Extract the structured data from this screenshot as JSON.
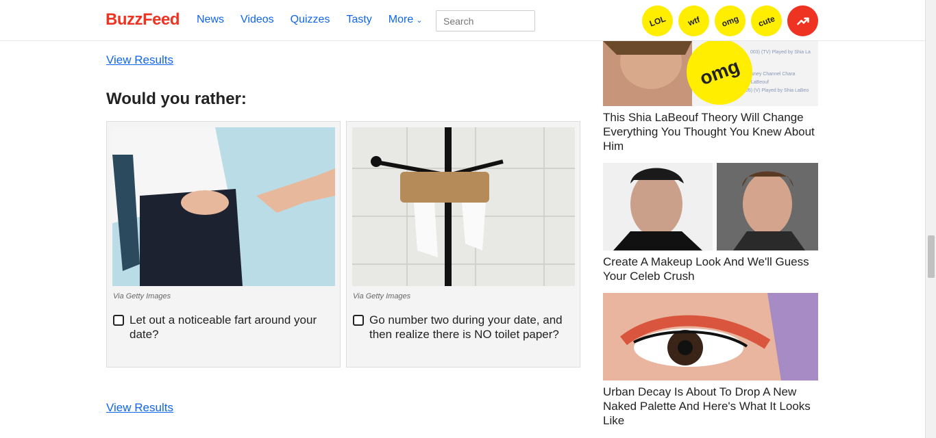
{
  "header": {
    "logo": "BuzzFeed",
    "nav": [
      "News",
      "Videos",
      "Quizzes",
      "Tasty",
      "More"
    ],
    "search_placeholder": "Search",
    "badges": [
      "LOL",
      "wtf",
      "omg",
      "cute"
    ],
    "trending_icon": "trending-icon"
  },
  "main": {
    "view_results_top": "View Results",
    "question": "Would you rather:",
    "options": [
      {
        "credit": "Via Getty Images",
        "label": "Let out a noticeable fart around your date?"
      },
      {
        "credit": "Via Getty Images",
        "label": "Go number two during your date, and then realize there is NO toilet paper?"
      }
    ],
    "view_results_bottom": "View Results"
  },
  "sidebar": {
    "items": [
      {
        "title": "This Shia LaBeouf Theory Will Change Everything You Thought You Knew About Him",
        "badge": "omg"
      },
      {
        "title": "Create A Makeup Look And We'll Guess Your Celeb Crush"
      },
      {
        "title": "Urban Decay Is About To Drop A New Naked Palette And Here's What It Looks Like"
      }
    ]
  },
  "colors": {
    "accent": "#0f65ef",
    "brand": "#ee3322",
    "badge": "#ffee00"
  }
}
